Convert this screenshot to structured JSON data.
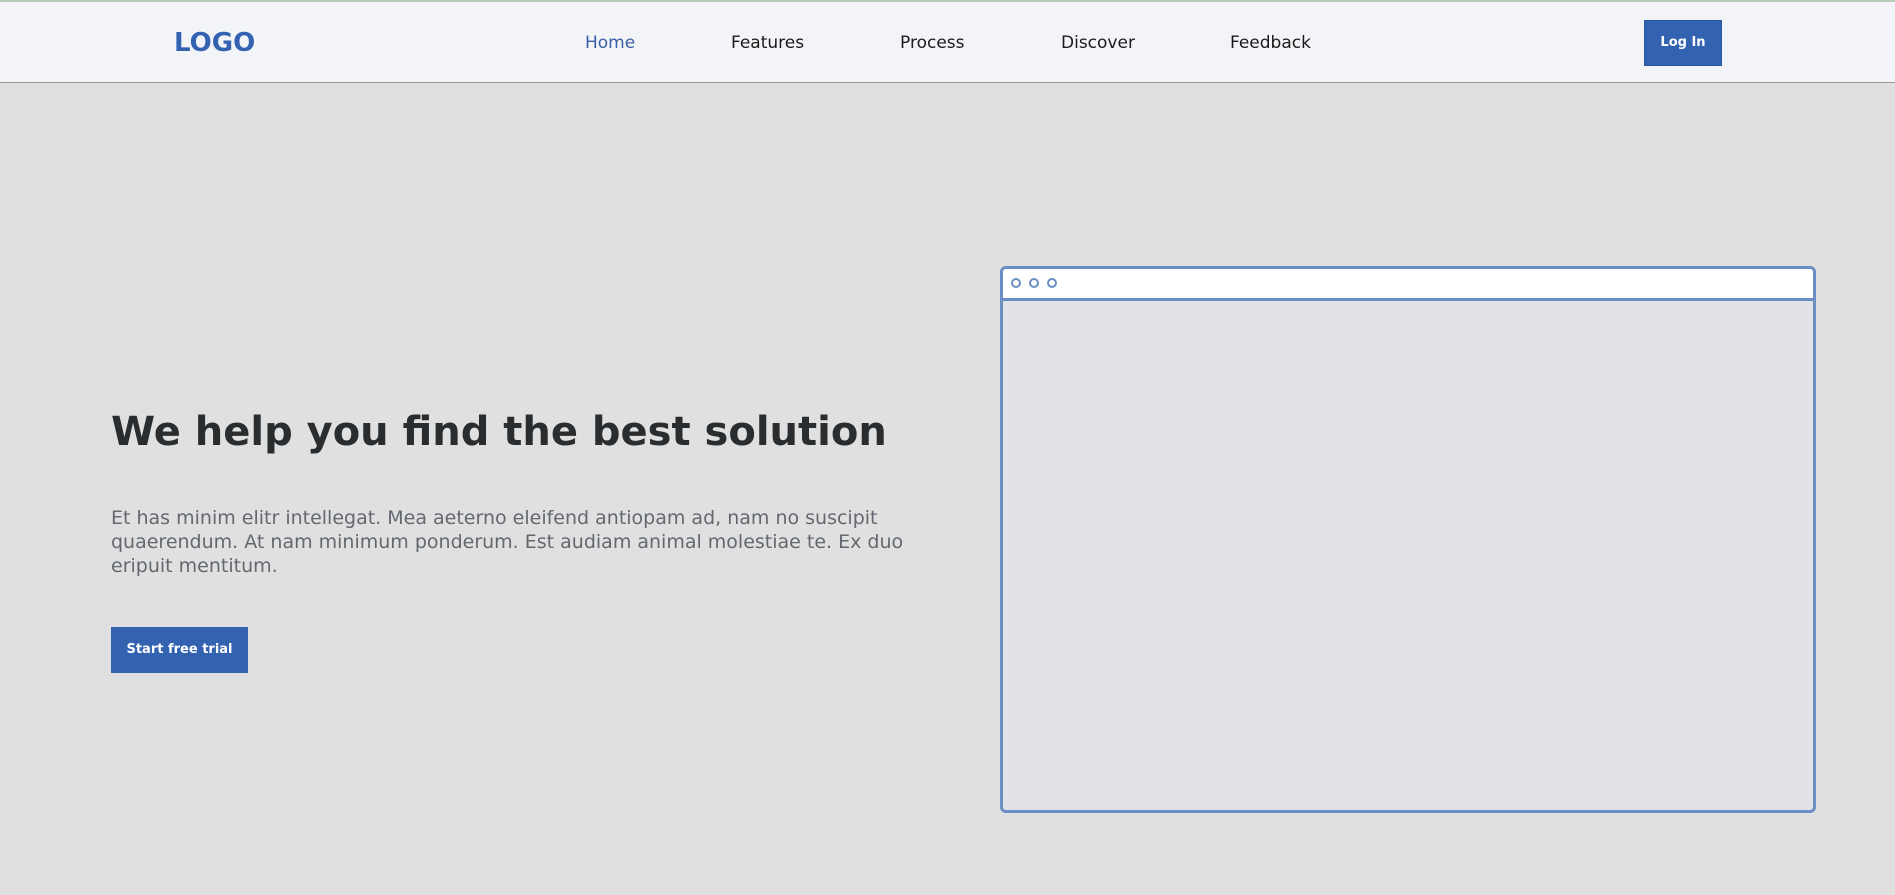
{
  "header": {
    "logo": "LOGO",
    "nav": [
      {
        "label": "Home",
        "active": true
      },
      {
        "label": "Features",
        "active": false
      },
      {
        "label": "Process",
        "active": false
      },
      {
        "label": "Discover",
        "active": false
      },
      {
        "label": "Feedback",
        "active": false
      }
    ],
    "login_label": "Log In"
  },
  "hero": {
    "title": "We help you find the best solution",
    "text": "Et has minim elitr intellegat. Mea aeterno eleifend antiopam ad, nam no suscipit quaerendum. At nam minimum ponderum. Est audiam animal molestiae te. Ex duo eripuit mentitum.",
    "cta_label": "Start free trial"
  },
  "colors": {
    "accent": "#3262b0",
    "nav_background": "#f3f4f8",
    "page_background": "#e0e0e0",
    "mockup_border": "#6b8fc4"
  }
}
